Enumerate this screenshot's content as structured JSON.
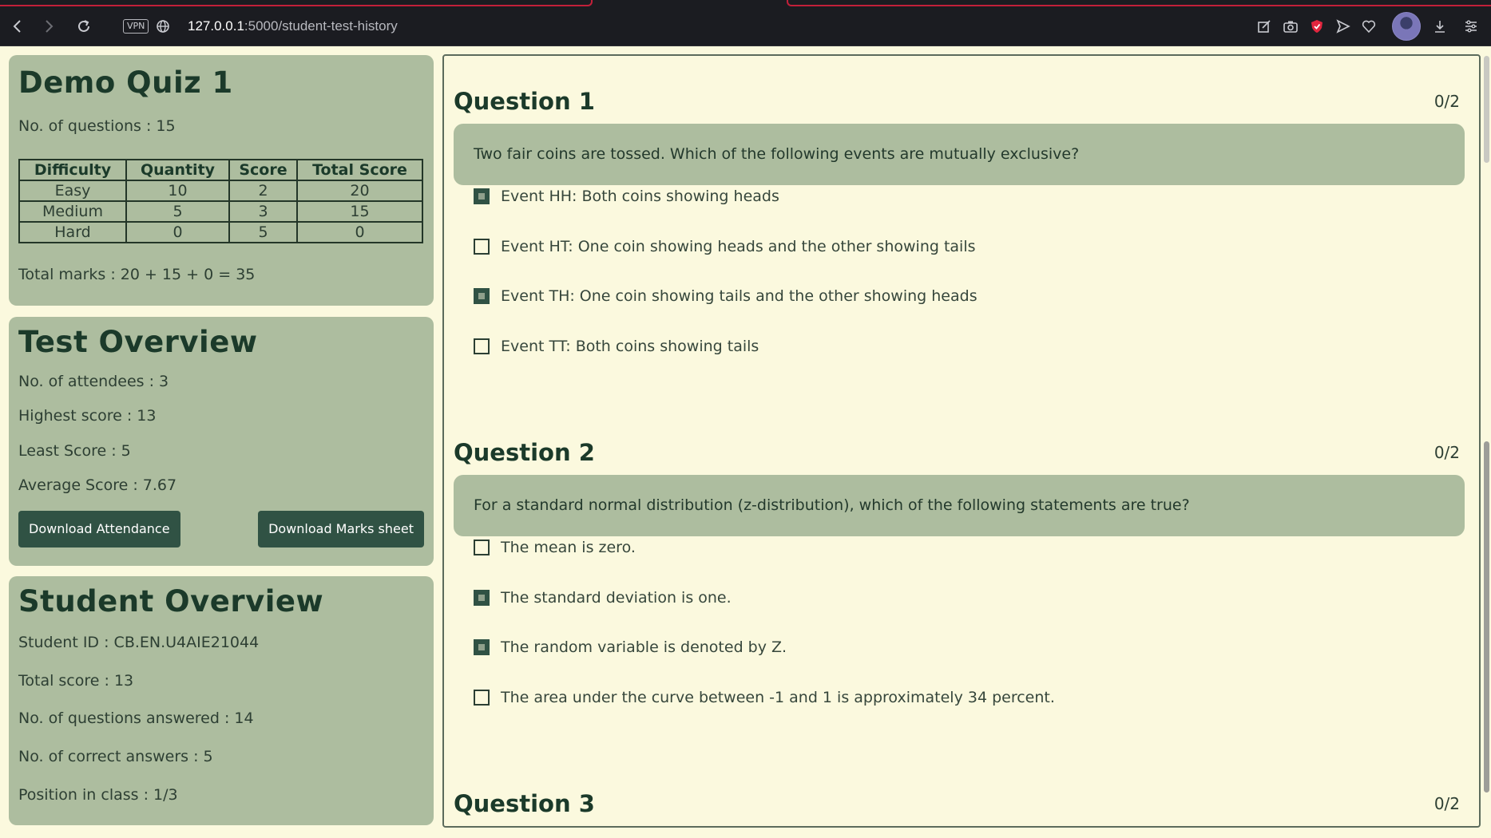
{
  "browser": {
    "vpn_label": "VPN",
    "url_host": "127.0.0.1",
    "url_rest": ":5000/student-test-history"
  },
  "quiz": {
    "title": "Demo Quiz 1",
    "num_questions": "No. of questions : 15",
    "table_headers": [
      "Difficulty",
      "Quantity",
      "Score",
      "Total Score"
    ],
    "rows": [
      [
        "Easy",
        "10",
        "2",
        "20"
      ],
      [
        "Medium",
        "5",
        "3",
        "15"
      ],
      [
        "Hard",
        "0",
        "5",
        "0"
      ]
    ],
    "total_marks": "Total marks : 20 + 15 + 0 = 35"
  },
  "test_overview": {
    "title": "Test Overview",
    "attendees": "No. of attendees : 3",
    "highest": "Highest score : 13",
    "least": "Least Score : 5",
    "average": "Average Score : 7.67",
    "download_attendance": "Download Attendance",
    "download_marks": "Download Marks sheet"
  },
  "student_overview": {
    "title": "Student Overview",
    "student_id": "Student ID : CB.EN.U4AIE21044",
    "total_score": "Total score : 13",
    "answered": "No. of questions answered : 14",
    "correct": "No. of correct answers : 5",
    "position": "Position in class : 1/3"
  },
  "questions": [
    {
      "title": "Question 1",
      "score": "0/2",
      "text": "Two fair coins are tossed. Which of the following events are mutually exclusive?",
      "options": [
        {
          "label": "Event HH: Both coins showing heads",
          "checked": true
        },
        {
          "label": "Event HT: One coin showing heads and the other showing tails",
          "checked": false
        },
        {
          "label": "Event TH: One coin showing tails and the other showing heads",
          "checked": true
        },
        {
          "label": "Event TT: Both coins showing tails",
          "checked": false
        }
      ]
    },
    {
      "title": "Question 2",
      "score": "0/2",
      "text": "For a standard normal distribution (z-distribution), which of the following statements are true?",
      "options": [
        {
          "label": "The mean is zero.",
          "checked": false
        },
        {
          "label": "The standard deviation is one.",
          "checked": true
        },
        {
          "label": "The random variable is denoted by Z.",
          "checked": true
        },
        {
          "label": "The area under the curve between -1 and 1 is approximately 34 percent.",
          "checked": false
        }
      ]
    },
    {
      "title": "Question 3",
      "score": "0/2"
    }
  ]
}
